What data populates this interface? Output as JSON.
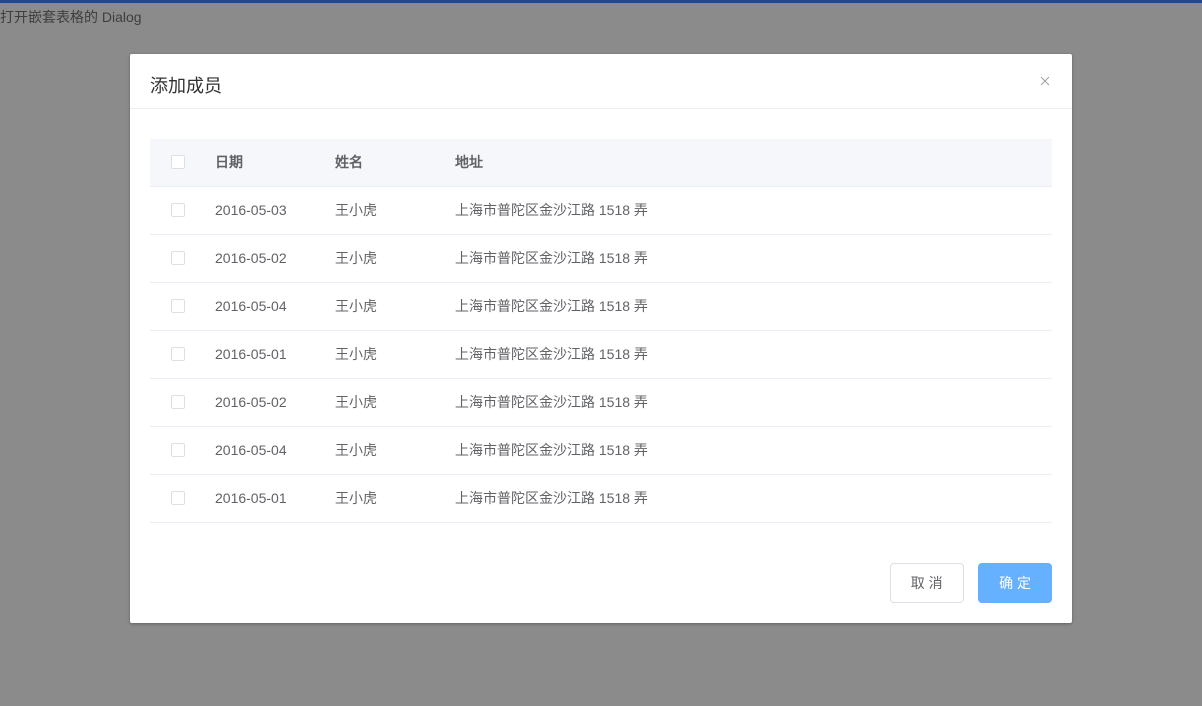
{
  "page": {
    "trigger_text": "打开嵌套表格的 Dialog"
  },
  "dialog": {
    "title": "添加成员",
    "footer": {
      "cancel_label": "取 消",
      "confirm_label": "确 定"
    }
  },
  "table": {
    "headers": {
      "date": "日期",
      "name": "姓名",
      "address": "地址"
    },
    "rows": [
      {
        "date": "2016-05-03",
        "name": "王小虎",
        "address": "上海市普陀区金沙江路 1518 弄"
      },
      {
        "date": "2016-05-02",
        "name": "王小虎",
        "address": "上海市普陀区金沙江路 1518 弄"
      },
      {
        "date": "2016-05-04",
        "name": "王小虎",
        "address": "上海市普陀区金沙江路 1518 弄"
      },
      {
        "date": "2016-05-01",
        "name": "王小虎",
        "address": "上海市普陀区金沙江路 1518 弄"
      },
      {
        "date": "2016-05-02",
        "name": "王小虎",
        "address": "上海市普陀区金沙江路 1518 弄"
      },
      {
        "date": "2016-05-04",
        "name": "王小虎",
        "address": "上海市普陀区金沙江路 1518 弄"
      },
      {
        "date": "2016-05-01",
        "name": "王小虎",
        "address": "上海市普陀区金沙江路 1518 弄"
      }
    ]
  }
}
